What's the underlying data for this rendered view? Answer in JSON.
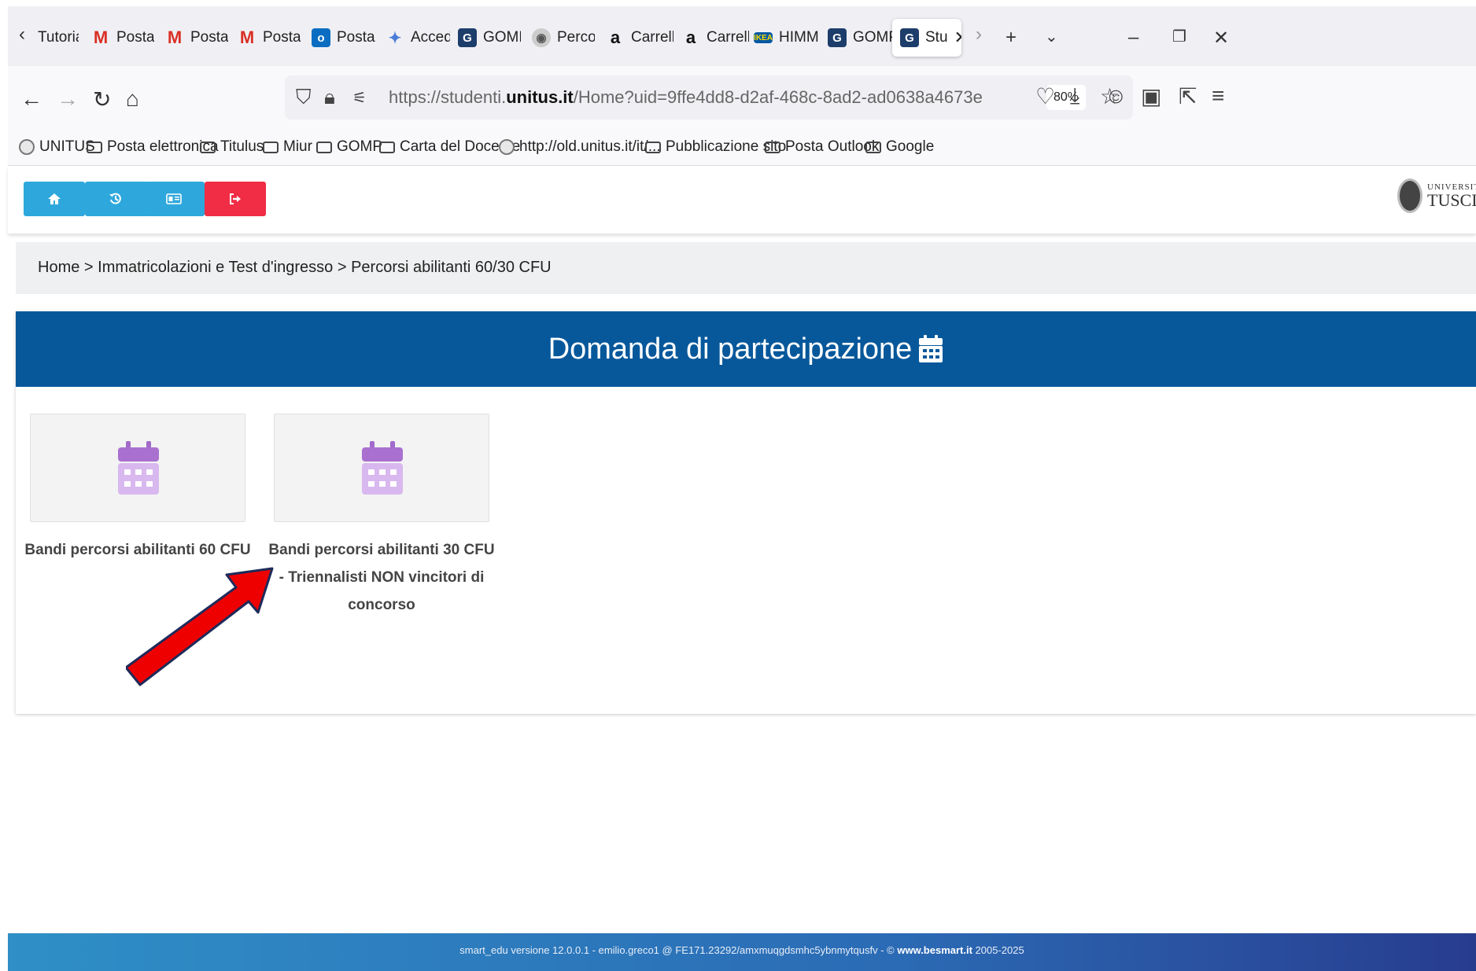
{
  "browser": {
    "tabs": [
      {
        "label": "Tutoria",
        "favicon": "tutorial-page-icon"
      },
      {
        "label": "Posta i",
        "favicon": "gmail-icon"
      },
      {
        "label": "Posta i",
        "favicon": "gmail-icon"
      },
      {
        "label": "Posta i",
        "favicon": "gmail-icon"
      },
      {
        "label": "Posta -",
        "favicon": "outlook-icon"
      },
      {
        "label": "Accedi",
        "favicon": "butterfly-icon"
      },
      {
        "label": "GOMP",
        "favicon": "gomp-icon"
      },
      {
        "label": "Percors",
        "favicon": "unitus-seal-icon"
      },
      {
        "label": "Carrell",
        "favicon": "amazon-icon"
      },
      {
        "label": "Carrell",
        "favicon": "amazon-icon"
      },
      {
        "label": "HIMM",
        "favicon": "ikea-icon"
      },
      {
        "label": "GOMP",
        "favicon": "gomp-icon"
      },
      {
        "label": "Stu",
        "favicon": "gomp-icon",
        "active": true
      }
    ],
    "url_prefix": "https://studenti.",
    "url_domain": "unitus.it",
    "url_path": "/Home?uid=9ffe4dd8-d2af-468c-8ad2-ad0638a4673e",
    "zoom": "80%",
    "bookmarks": [
      {
        "label": "UNITUS",
        "icon": "unitus-seal-icon"
      },
      {
        "label": "Posta elettronica",
        "icon": "folder-icon"
      },
      {
        "label": "Titulus",
        "icon": "folder-icon"
      },
      {
        "label": "Miur",
        "icon": "folder-icon"
      },
      {
        "label": "GOMP",
        "icon": "folder-icon"
      },
      {
        "label": "Carta del Docente",
        "icon": "folder-icon"
      },
      {
        "label": "http://old.unitus.it/it/...",
        "icon": "globe-icon"
      },
      {
        "label": "Pubblicazione sito",
        "icon": "folder-icon"
      },
      {
        "label": "Posta Outlook",
        "icon": "folder-icon"
      },
      {
        "label": "Google",
        "icon": "folder-icon"
      }
    ]
  },
  "toolbar": {
    "buttons": [
      {
        "icon": "home-icon",
        "color": "#2ea8dc"
      },
      {
        "icon": "history-icon",
        "color": "#2ea8dc"
      },
      {
        "icon": "id-card-icon",
        "color": "#2ea8dc"
      },
      {
        "icon": "logout-icon",
        "color": "#f02d45"
      }
    ],
    "logo_line1": "UNIVERSITÀ",
    "logo_line2": "TUSCIA"
  },
  "breadcrumb": "Home > Immatricolazioni e Test d'ingresso > Percorsi abilitanti 60/30 CFU",
  "card": {
    "title": "Domanda di partecipazione",
    "header_color": "#07589b",
    "tiles": [
      {
        "label": "Bandi percorsi abilitanti 60 CFU",
        "icon": "calendar-icon"
      },
      {
        "label": "Bandi percorsi abilitanti 30 CFU - Triennalisti NON vincitori di concorso",
        "icon": "calendar-icon"
      }
    ],
    "icon_color": "#b07fd4"
  },
  "annotation": {
    "color": "#ee0000",
    "outline": "#1f2b5a"
  },
  "footer": {
    "text": "smart_edu versione 12.0.0.1 - emilio.greco1 @ FE171.23292/amxmuqgdsmhc5ybnmytqusfv - © ",
    "link": "www.besmart.it",
    "years": " 2005-2025"
  }
}
